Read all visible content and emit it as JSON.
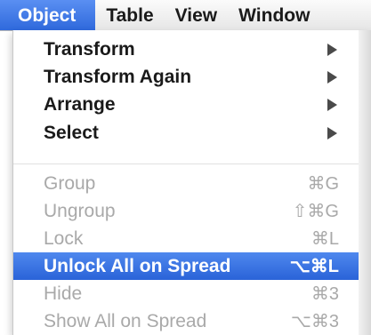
{
  "menubar": {
    "items": [
      {
        "label": "Object",
        "active": true
      },
      {
        "label": "Table",
        "active": false
      },
      {
        "label": "View",
        "active": false
      },
      {
        "label": "Window",
        "active": false
      }
    ]
  },
  "menu": {
    "items": [
      {
        "label": "Transform",
        "submenu": true,
        "enabled": true,
        "shortcut": ""
      },
      {
        "label": "Transform Again",
        "submenu": true,
        "enabled": true,
        "shortcut": ""
      },
      {
        "label": "Arrange",
        "submenu": true,
        "enabled": true,
        "shortcut": ""
      },
      {
        "label": "Select",
        "submenu": true,
        "enabled": true,
        "shortcut": ""
      },
      {
        "label": "Group",
        "submenu": false,
        "enabled": false,
        "shortcut": "⌘G"
      },
      {
        "label": "Ungroup",
        "submenu": false,
        "enabled": false,
        "shortcut": "⇧⌘G"
      },
      {
        "label": "Lock",
        "submenu": false,
        "enabled": false,
        "shortcut": "⌘L"
      },
      {
        "label": "Unlock All on Spread",
        "submenu": false,
        "enabled": true,
        "highlighted": true,
        "shortcut": "⌥⌘L"
      },
      {
        "label": "Hide",
        "submenu": false,
        "enabled": false,
        "shortcut": "⌘3"
      },
      {
        "label": "Show All on Spread",
        "submenu": false,
        "enabled": false,
        "shortcut": "⌥⌘3"
      }
    ]
  },
  "colors": {
    "highlight": "#2f69dc",
    "disabled_text": "#a9a9a9"
  }
}
